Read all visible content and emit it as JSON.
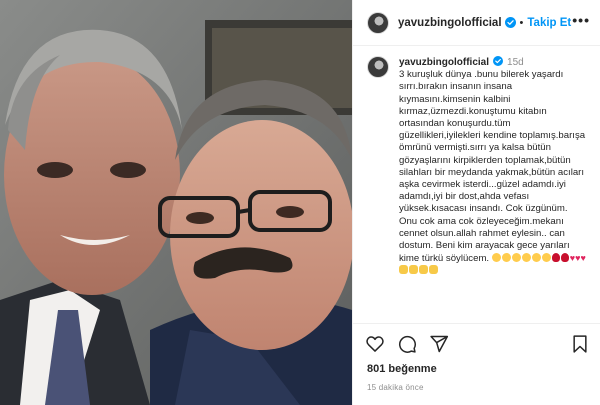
{
  "header": {
    "username": "yavuzbingolofficial",
    "separator": "•",
    "follow_label": "Takip Et",
    "more_label": "•••"
  },
  "caption": {
    "username": "yavuzbingolofficial",
    "time": "15d",
    "text": "3 kuruşluk dünya .bunu bilerek yaşardı sırrı.bırakın insanın insana kıymasını.kimsenin kalbini kırmaz,üzmezdi.konuştumu kitabın ortasından konuşurdu.tüm güzellikleri,iyilekleri kendine toplamış.barışa ömrünü vermişti.sırrı ya kalsa bütün gözyaşlarını kirpiklerden toplamak,bütün silahları bir meydanda yakmak,bütün acıları aşka cevirmek isterdi...güzel adamdı.iyi adamdı,iyi bir dost,ahda vefası yüksek.kısacası insandı. Cok üzgünüm. Onu cok ama cok özleyeceğim.mekanı cennet olsun.allah rahmet eylesin.. can dostum. Beni kim arayacak gece yarıları kime türkü söylücem."
  },
  "icons": {
    "verified": "verified-badge-icon",
    "like": "heart-icon",
    "comment": "comment-icon",
    "share": "paper-plane-icon",
    "save": "bookmark-icon"
  },
  "stats": {
    "likes": "801 beğenme",
    "posted_ago": "15 dakika önce"
  },
  "colors": {
    "accent": "#0095f6",
    "text": "#262626",
    "muted": "#8e8e8e"
  }
}
